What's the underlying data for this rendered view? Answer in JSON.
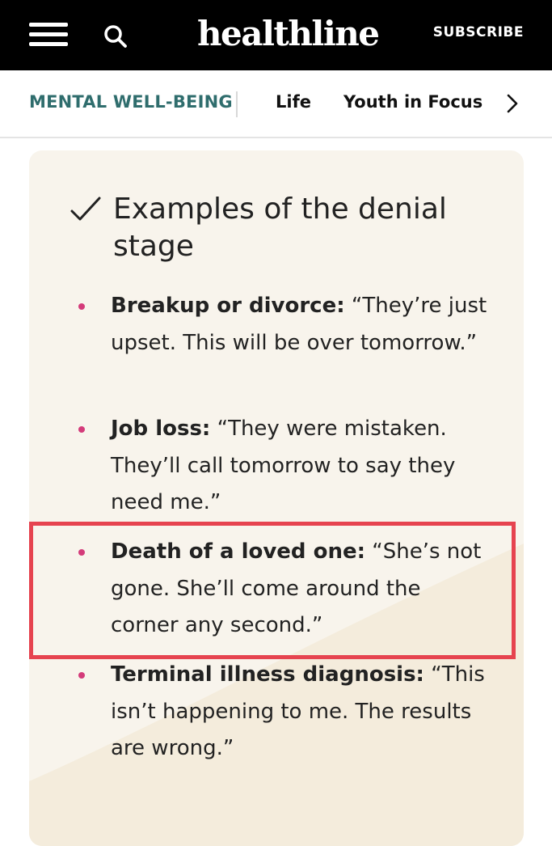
{
  "header": {
    "logo": "healthline",
    "subscribe_label": "SUBSCRIBE"
  },
  "subnav": {
    "section": "MENTAL WELL-BEING",
    "links": [
      "Life",
      "Youth in Focus"
    ]
  },
  "card": {
    "title": "Examples of the denial stage",
    "items": [
      {
        "label": "Breakup or divorce:",
        "text": " “They’re just upset. This will be over tomorrow.”"
      },
      {
        "label": "Job loss:",
        "text": " “They were mistaken. They’ll call tomorrow to say they need me.”"
      },
      {
        "label": "Death of a loved one:",
        "text": " “She’s not gone. She’ll come around the corner any second.”"
      },
      {
        "label": "Terminal illness diagnosis:",
        "text": " “This isn’t happening to me. The results are wrong.”"
      }
    ]
  },
  "colors": {
    "topbar": "#000000",
    "section_link": "#2f6d6d",
    "card_bg": "#f8f4ec",
    "bullet": "#d43b7a",
    "highlight": "#e6434f"
  },
  "icons": [
    "menu-icon",
    "search-icon",
    "chevron-right-icon",
    "checkmark-icon"
  ]
}
